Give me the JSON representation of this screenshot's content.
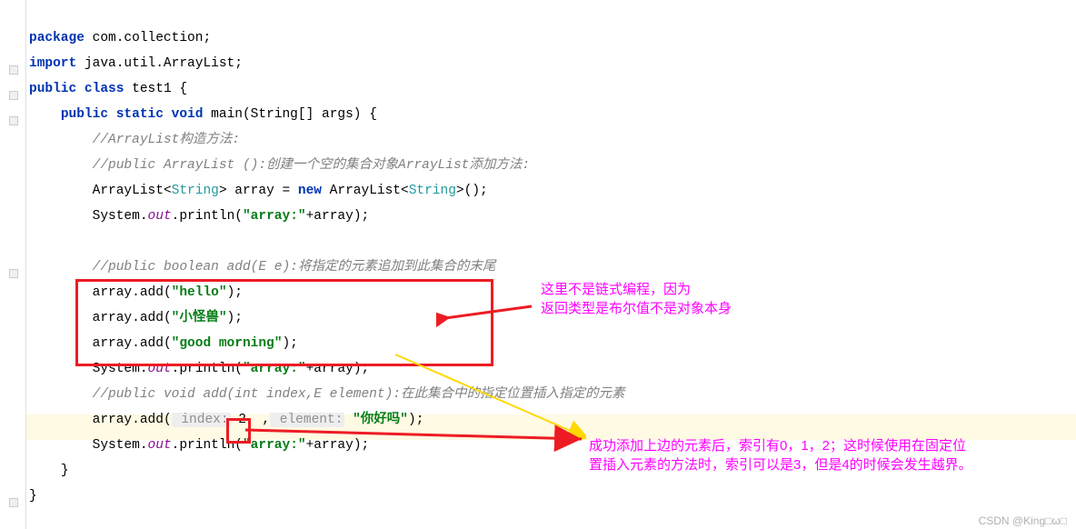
{
  "code": {
    "l1_kw1": "package",
    "l1_rest": " com.collection;",
    "l2_kw1": "import",
    "l2_rest": " java.util.ArrayList;",
    "l3_kw1": "public",
    "l3_kw2": "class",
    "l3_name": " test1 {",
    "l4_kw1": "public",
    "l4_kw2": "static",
    "l4_kw3": "void",
    "l4_sig": " main(String[] args) {",
    "l5_comment": "//ArrayList构造方法:",
    "l6_comment": "//public ArrayList ():创建一个空的集合对象ArrayList添加方法:",
    "l7_a": "ArrayList<",
    "l7_t1": "String",
    "l7_b": "> array = ",
    "l7_new": "new",
    "l7_c": " ArrayList<",
    "l7_t2": "String",
    "l7_d": ">();",
    "l8_a": "System.",
    "l8_out": "out",
    "l8_b": ".println(",
    "l8_s": "\"array:\"",
    "l8_c": "+array);",
    "l9_comment": "//public boolean add(E e):将指定的元素追加到此集合的末尾",
    "l10_a": "array.add(",
    "l10_s": "\"hello\"",
    "l10_b": ");",
    "l11_a": "array.add(",
    "l11_s": "\"小怪兽\"",
    "l11_b": ");",
    "l12_a": "array.add(",
    "l12_s": "\"good morning\"",
    "l12_b": ");",
    "l13_a": "System.",
    "l13_out": "out",
    "l13_b": ".println(",
    "l13_s": "\"array:\"",
    "l13_c": "+array);",
    "l14_comment": "//public void add(int index,E element):在此集合中的指定位置插入指定的元素",
    "l15_a": "array.add(",
    "l15_h1": " index:",
    "l15_v1": " 2 ",
    "l15_c": " ,",
    "l15_h2": " element:",
    "l15_s": " \"你好吗\"",
    "l15_b": ");",
    "l16_a": "System.",
    "l16_out": "out",
    "l16_b": ".println(",
    "l16_s": "\"array:\"",
    "l16_c": "+array);",
    "l17": "}",
    "l18": "}"
  },
  "annotations": {
    "a1_l1": "这里不是链式编程，因为",
    "a1_l2": "返回类型是布尔值不是对象本身",
    "a2_l1": "成功添加上边的元素后，索引有0，1，2；这时候使用在固定位",
    "a2_l2": "置插入元素的方法时，索引可以是3，但是4的时候会发生越界。"
  },
  "footer": "CSDN @King□ω□"
}
